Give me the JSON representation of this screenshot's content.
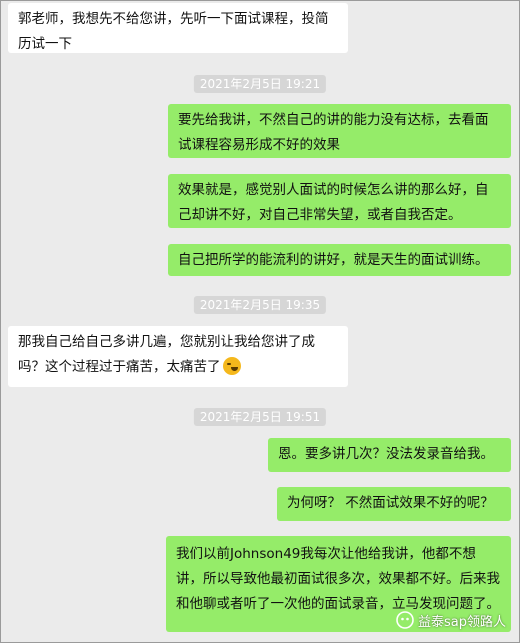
{
  "messages": [
    {
      "side": "left",
      "text": "郭老师，我想先不给您讲，先听一下面试课程，投简历试一下"
    },
    {
      "side": "time",
      "text": "2021年2月5日 19:21"
    },
    {
      "side": "right",
      "text": "要先给我讲，不然自己的讲的能力没有达标，去看面试课程容易形成不好的效果"
    },
    {
      "side": "right",
      "text": "效果就是，感觉别人面试的时候怎么讲的那么好，自己却讲不好，对自己非常失望，或者自我否定。"
    },
    {
      "side": "right",
      "text": "自己把所学的能流利的讲好，就是天生的面试训练。"
    },
    {
      "side": "time",
      "text": "2021年2月5日 19:35"
    },
    {
      "side": "left",
      "text": "那我自己给自己多讲几遍，您就别让我给您讲了成吗？这个过程过于痛苦，太痛苦了"
    },
    {
      "side": "time",
      "text": "2021年2月5日 19:51"
    },
    {
      "side": "right",
      "text": "恩。要多讲几次？没法发录音给我。"
    },
    {
      "side": "right",
      "text": "为何呀？ 不然面试效果不好的呢？"
    },
    {
      "side": "right",
      "text": "我们以前Johnson49我每次让他给我讲，他都不想讲，所以导致他最初面试很多次，效果都不好。后来我和他聊或者听了一次他的面试录音，立马发现问题了。"
    }
  ],
  "watermark": {
    "text": "益泰sap领路人",
    "icon": "wechat-official-icon"
  },
  "colors": {
    "background": "#ebebeb",
    "left_bubble": "#ffffff",
    "right_bubble": "#95ec69",
    "timestamp_bg": "#d6d6d6"
  }
}
